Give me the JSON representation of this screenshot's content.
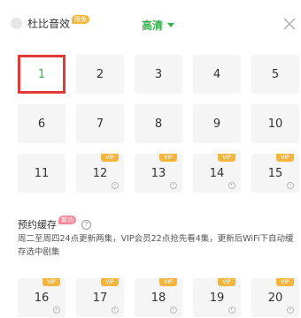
{
  "header": {
    "dolby_label": "杜比音效",
    "dolby_badge": "限免",
    "quality_label": "高清",
    "colors": {
      "accent_green": "#33b24b",
      "badge_yellow": "#f2b53d"
    }
  },
  "episodes": [
    {
      "label": "1",
      "vip": false,
      "selected": true
    },
    {
      "label": "2",
      "vip": false
    },
    {
      "label": "3",
      "vip": false
    },
    {
      "label": "4",
      "vip": false
    },
    {
      "label": "5",
      "vip": false
    },
    {
      "label": "6",
      "vip": false
    },
    {
      "label": "7",
      "vip": false
    },
    {
      "label": "8",
      "vip": false
    },
    {
      "label": "9",
      "vip": false
    },
    {
      "label": "10",
      "vip": false
    },
    {
      "label": "11",
      "vip": false
    },
    {
      "label": "12",
      "vip": true,
      "vip_text": "VIP",
      "clock": true
    },
    {
      "label": "13",
      "vip": true,
      "vip_text": "VIP",
      "clock": true
    },
    {
      "label": "14",
      "vip": true,
      "vip_text": "VIP",
      "clock": true
    },
    {
      "label": "15",
      "vip": true,
      "vip_text": "VIP",
      "clock": true
    }
  ],
  "reserve": {
    "title": "预约缓存",
    "badge": "新功",
    "help_icon": "?",
    "description": "周二至周四24点更新两集，VIP会员22点抢先看4集，更新后WiFi下自动缓存选中剧集"
  },
  "reserve_episodes": [
    {
      "label": "16",
      "vip_text": "VIP"
    },
    {
      "label": "17",
      "vip_text": "VIP"
    },
    {
      "label": "18",
      "vip_text": "VIP"
    },
    {
      "label": "19",
      "vip_text": "VIP"
    },
    {
      "label": "20",
      "vip_text": "VIP"
    }
  ]
}
